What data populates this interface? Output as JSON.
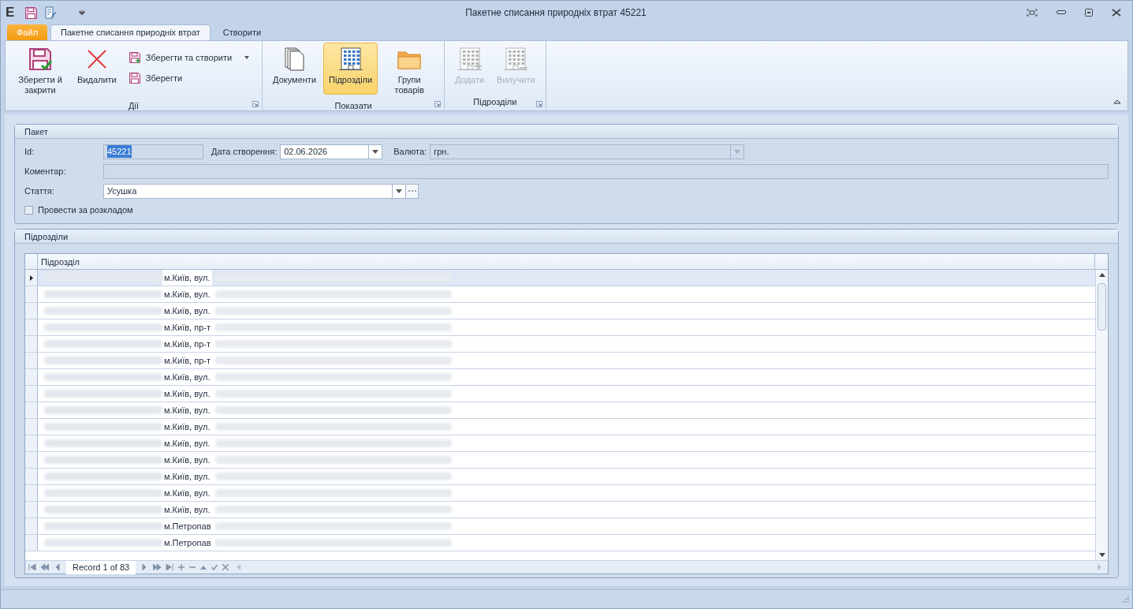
{
  "window": {
    "app_letter": "E",
    "title": "Пакетне списання природніх втрат 45221"
  },
  "tabs": [
    {
      "label": "Файл",
      "kind": "file",
      "selected": false
    },
    {
      "label": "Пакетне списання природніх втрат",
      "kind": "tab",
      "selected": true
    },
    {
      "label": "Створити",
      "kind": "tab",
      "selected": false
    }
  ],
  "ribbon_groups": [
    {
      "title": "Дії",
      "items": [
        {
          "label": "Зберегти й закрити",
          "kind": "large",
          "selected": false,
          "disabled": false
        },
        {
          "label": "Видалити",
          "kind": "large",
          "selected": false,
          "disabled": false
        },
        {
          "kind": "stack",
          "items": [
            {
              "label": "Зберегти та створити",
              "dropdown": true
            },
            {
              "label": "Зберегти",
              "dropdown": false
            }
          ]
        }
      ]
    },
    {
      "title": "Показати",
      "items": [
        {
          "label": "Документи",
          "kind": "large",
          "selected": false,
          "disabled": false
        },
        {
          "label": "Підрозділи",
          "kind": "large",
          "selected": true,
          "disabled": false
        },
        {
          "label": "Групи товарів",
          "kind": "large",
          "selected": false,
          "disabled": false
        }
      ]
    },
    {
      "title": "Підрозділи",
      "items": [
        {
          "label": "Додати",
          "kind": "large",
          "selected": false,
          "disabled": true
        },
        {
          "label": "Вилучити",
          "kind": "large",
          "selected": false,
          "disabled": true
        }
      ]
    }
  ],
  "packet": {
    "title": "Пакет",
    "id_label": "Id:",
    "id_value": "45221",
    "date_label": "Дата створення:",
    "date_value": "02.06.2026",
    "currency_label": "Валюта:",
    "currency_value": "грн.",
    "comment_label": "Коментар:",
    "article_label": "Стаття:",
    "article_value": "Усушка",
    "schedule": {
      "label": "Провести за розкладом",
      "checked": false
    }
  },
  "units": {
    "title": "Підрозділи",
    "column": "Підрозділ",
    "rows": [
      {
        "text": "м.Київ, вул.",
        "selected": true
      },
      {
        "text": "м.Київ, вул.",
        "selected": false
      },
      {
        "text": "м.Київ, вул.",
        "selected": false
      },
      {
        "text": "м.Київ, пр-т",
        "selected": false
      },
      {
        "text": "м.Київ, пр-т",
        "selected": false
      },
      {
        "text": "м.Київ, пр-т",
        "selected": false
      },
      {
        "text": "м.Київ, вул.",
        "selected": false
      },
      {
        "text": "м.Київ, вул.",
        "selected": false
      },
      {
        "text": "м.Київ, вул.",
        "selected": false
      },
      {
        "text": "м.Київ, вул.",
        "selected": false
      },
      {
        "text": "м.Київ, вул.",
        "selected": false
      },
      {
        "text": "м.Київ, вул.",
        "selected": false
      },
      {
        "text": "м.Київ, вул.",
        "selected": false
      },
      {
        "text": "м.Київ, вул.",
        "selected": false
      },
      {
        "text": "м.Київ, вул.",
        "selected": false
      },
      {
        "text": "м.Петропав",
        "selected": false
      },
      {
        "text": "м.Петропав",
        "selected": false
      }
    ],
    "navigator": "Record 1 of 83"
  }
}
